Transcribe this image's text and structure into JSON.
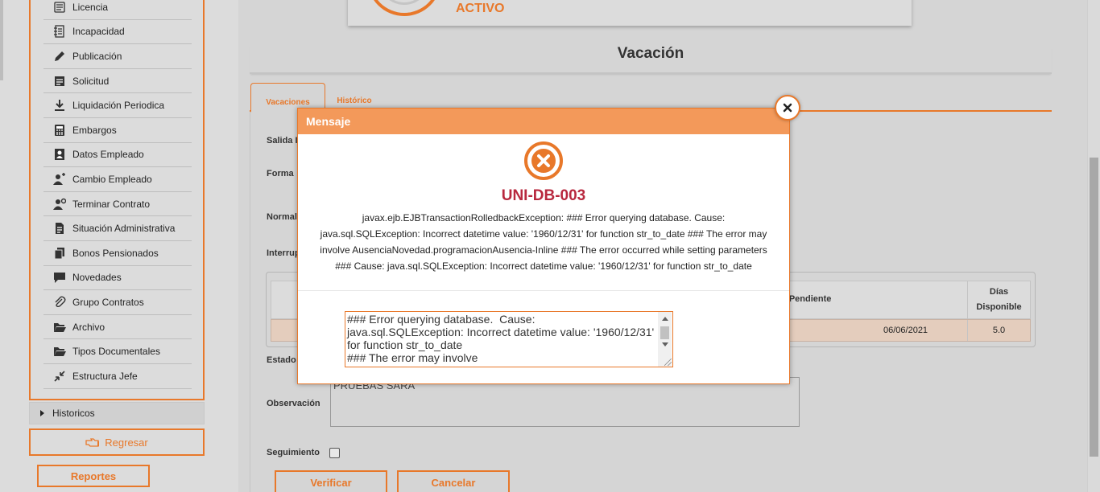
{
  "sidebar": {
    "items": [
      {
        "label": "Licencia",
        "icon": "license-icon"
      },
      {
        "label": "Incapacidad",
        "icon": "disability-icon"
      },
      {
        "label": "Publicación",
        "icon": "pen-icon"
      },
      {
        "label": "Solicitud",
        "icon": "request-icon"
      },
      {
        "label": "Liquidación Periodica",
        "icon": "download-icon"
      },
      {
        "label": "Embargos",
        "icon": "calculator-icon"
      },
      {
        "label": "Datos Empleado",
        "icon": "employee-card-icon"
      },
      {
        "label": "Cambio Empleado",
        "icon": "user-change-icon"
      },
      {
        "label": "Terminar Contrato",
        "icon": "user-terminate-icon"
      },
      {
        "label": "Situación Administrativa",
        "icon": "document-icon"
      },
      {
        "label": "Bonos Pensionados",
        "icon": "bonds-icon"
      },
      {
        "label": "Novedades",
        "icon": "comment-icon"
      },
      {
        "label": "Grupo Contratos",
        "icon": "paperclip-icon"
      },
      {
        "label": "Archivo",
        "icon": "folder-open-icon"
      },
      {
        "label": "Tipos Documentales",
        "icon": "folder-open-icon"
      },
      {
        "label": "Estructura Jefe",
        "icon": "compress-icon"
      }
    ],
    "historicos_label": "Historicos",
    "regresar_label": "Regresar",
    "reportes_label": "Reportes"
  },
  "status": {
    "text": "ACTIVO"
  },
  "page": {
    "title": "Vacación"
  },
  "tabs": {
    "active": "Vacaciones",
    "inactive": "Histórico"
  },
  "form": {
    "label_salida": "Salida I",
    "label_forma": "Forma",
    "label_normal": "Normal",
    "label_interrup": "Interrup",
    "label_estado": "Estado",
    "label_observacion": "Observación",
    "observacion_value": "PRUEBAS SARA",
    "label_seguimiento": "Seguimiento",
    "btn_verificar": "Verificar",
    "btn_cancelar": "Cancelar"
  },
  "grid": {
    "col_pendiente": "io Pendiente",
    "col_dias_1": "Días",
    "col_dias_2": "Disponible",
    "row": {
      "date": "06/06/2021",
      "dias": "5.0"
    }
  },
  "modal": {
    "title": "Mensaje",
    "code": "UNI-DB-003",
    "message_lines": [
      "javax.ejb.EJBTransactionRolledbackException: ### Error querying database. Cause:",
      "java.sql.SQLException: Incorrect datetime value: '1960/12/31' for function str_to_date ### The error may",
      "involve AusenciaNovedad.programacionAusencia-Inline ### The error occurred while setting parameters",
      "### Cause: java.sql.SQLException: Incorrect datetime value: '1960/12/31' for function str_to_date"
    ],
    "detail": "### Error querying database.  Cause: java.sql.SQLException: Incorrect datetime value: '1960/12/31' for function str_to_date\n### The error may involve AusenciaNovedad.programacionAusencia-Inline"
  },
  "colors": {
    "accent": "#e8782a",
    "modal_header": "#f3995a",
    "error_code": "#b8283e"
  }
}
